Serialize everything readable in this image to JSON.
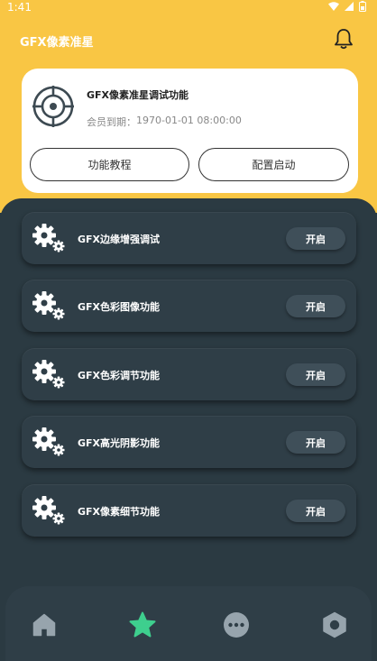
{
  "status_bar": {
    "time": "1:41"
  },
  "header": {
    "app_title": "GFX像素准星"
  },
  "card": {
    "title": "GFX像素准星调试功能",
    "expire_label": "会员到期：",
    "expire_value": "1970-01-01 08:00:00",
    "tutorial_label": "功能教程",
    "config_label": "配置启动"
  },
  "features": [
    {
      "label": "GFX边缘增强调试",
      "button": "开启"
    },
    {
      "label": "GFX色彩图像功能",
      "button": "开启"
    },
    {
      "label": "GFX色彩调节功能",
      "button": "开启"
    },
    {
      "label": "GFX高光阴影功能",
      "button": "开启"
    },
    {
      "label": "GFX像素细节功能",
      "button": "开启"
    }
  ],
  "colors": {
    "accent": "#f9c644",
    "background": "#2b3a42",
    "nav_active": "#3ecf8e",
    "nav_inactive": "#97a4ad"
  },
  "nav": [
    {
      "icon": "home-icon",
      "active": false
    },
    {
      "icon": "star-icon",
      "active": true
    },
    {
      "icon": "more-icon",
      "active": false
    },
    {
      "icon": "settings-icon",
      "active": false
    }
  ]
}
